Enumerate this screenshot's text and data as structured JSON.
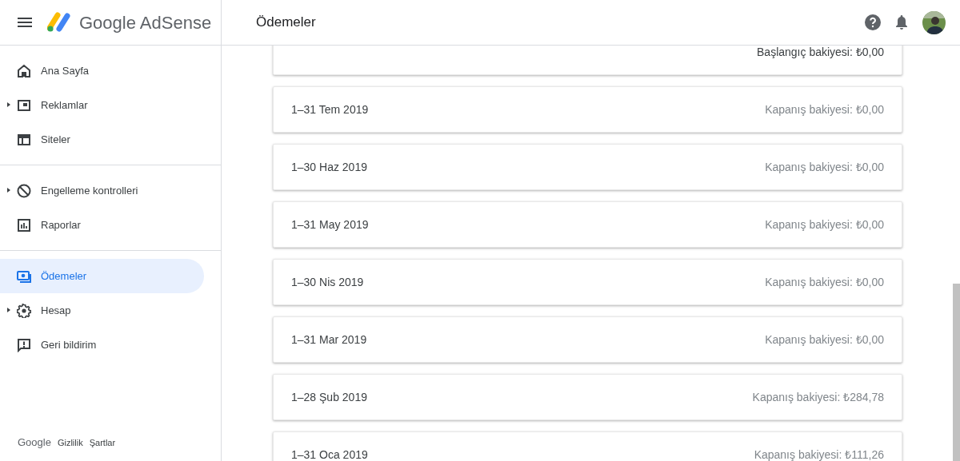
{
  "header": {
    "brand": "Google AdSense",
    "page_title": "Ödemeler"
  },
  "sidebar": {
    "groups": [
      [
        {
          "label": "Ana Sayfa",
          "expandable": false,
          "selected": false
        },
        {
          "label": "Reklamlar",
          "expandable": true,
          "selected": false
        },
        {
          "label": "Siteler",
          "expandable": false,
          "selected": false
        }
      ],
      [
        {
          "label": "Engelleme kontrolleri",
          "expandable": true,
          "selected": false
        },
        {
          "label": "Raporlar",
          "expandable": false,
          "selected": false
        }
      ],
      [
        {
          "label": "Ödemeler",
          "expandable": false,
          "selected": true
        },
        {
          "label": "Hesap",
          "expandable": true,
          "selected": false
        },
        {
          "label": "Geri bildirim",
          "expandable": false,
          "selected": false
        }
      ]
    ],
    "footer": {
      "brand": "Google",
      "links": [
        "Gizlilik",
        "Şartlar"
      ]
    }
  },
  "statements": [
    {
      "kind": "opening",
      "balance": "Başlangıç bakiyesi: ₺0,00"
    },
    {
      "kind": "closing",
      "period": "1–31 Tem 2019",
      "balance": "Kapanış bakiyesi: ₺0,00"
    },
    {
      "kind": "closing",
      "period": "1–30 Haz 2019",
      "balance": "Kapanış bakiyesi: ₺0,00"
    },
    {
      "kind": "closing",
      "period": "1–31 May 2019",
      "balance": "Kapanış bakiyesi: ₺0,00"
    },
    {
      "kind": "closing",
      "period": "1–30 Nis 2019",
      "balance": "Kapanış bakiyesi: ₺0,00"
    },
    {
      "kind": "closing",
      "period": "1–31 Mar 2019",
      "balance": "Kapanış bakiyesi: ₺0,00"
    },
    {
      "kind": "closing",
      "period": "1–28 Şub 2019",
      "balance": "Kapanış bakiyesi: ₺284,78"
    },
    {
      "kind": "closing",
      "period": "1–31 Oca 2019",
      "balance": "Kapanış bakiyesi: ₺111,26"
    }
  ]
}
